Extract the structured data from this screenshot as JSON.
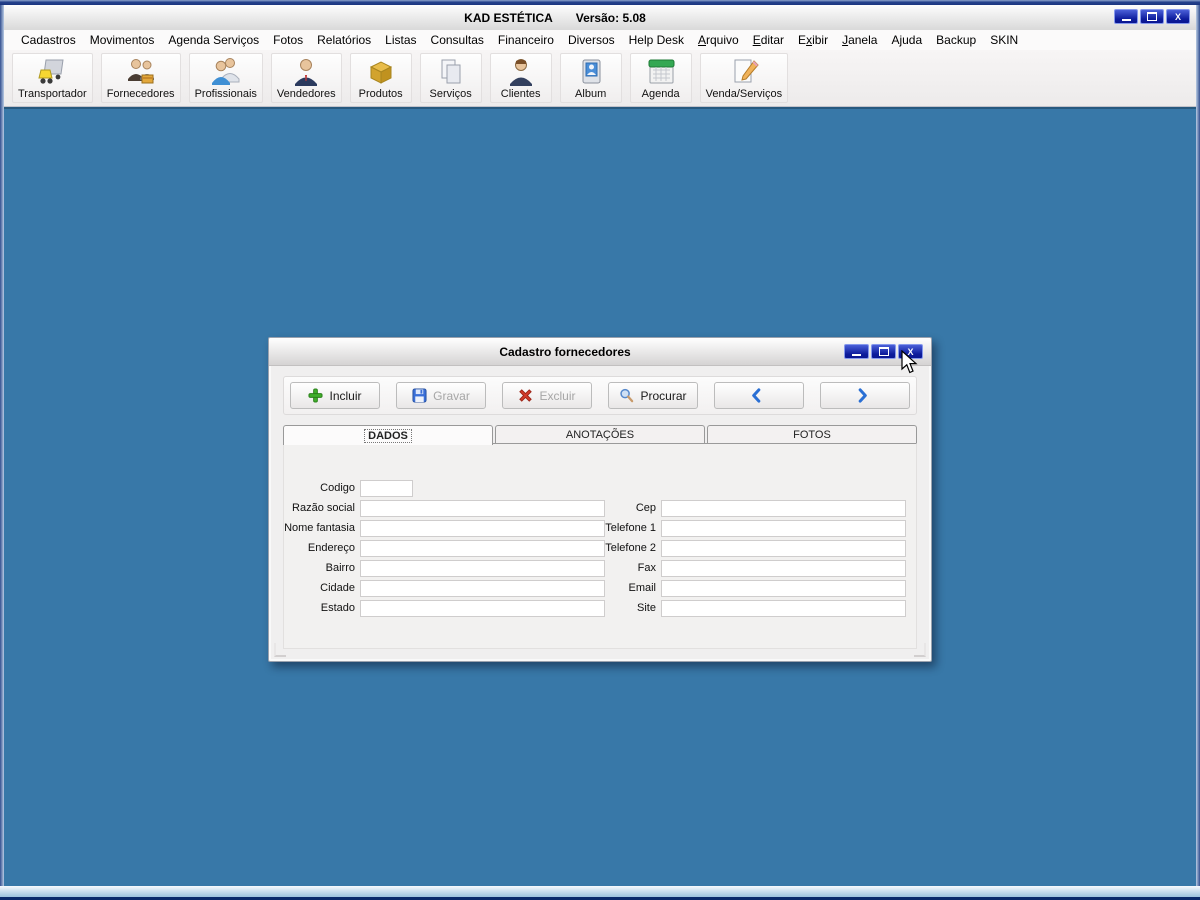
{
  "titlebar": {
    "app_title": "KAD ESTÉTICA",
    "version": "Versão: 5.08",
    "close_glyph": "X"
  },
  "menubar": {
    "items": [
      {
        "pre": "Cadastros",
        "accel": "",
        "rest": ""
      },
      {
        "pre": "Movimentos",
        "accel": "",
        "rest": ""
      },
      {
        "pre": "Agenda Serviços",
        "accel": "",
        "rest": ""
      },
      {
        "pre": "Fotos",
        "accel": "",
        "rest": ""
      },
      {
        "pre": "Relatórios",
        "accel": "",
        "rest": ""
      },
      {
        "pre": "Listas",
        "accel": "",
        "rest": ""
      },
      {
        "pre": "Consultas",
        "accel": "",
        "rest": ""
      },
      {
        "pre": "Financeiro",
        "accel": "",
        "rest": ""
      },
      {
        "pre": "Diversos",
        "accel": "",
        "rest": ""
      },
      {
        "pre": "Help Desk",
        "accel": "",
        "rest": ""
      },
      {
        "pre": "",
        "accel": "A",
        "rest": "rquivo"
      },
      {
        "pre": "",
        "accel": "E",
        "rest": "ditar"
      },
      {
        "pre": "E",
        "accel": "x",
        "rest": "ibir"
      },
      {
        "pre": "",
        "accel": "J",
        "rest": "anela"
      },
      {
        "pre": "Ajuda",
        "accel": "",
        "rest": ""
      },
      {
        "pre": "Backup",
        "accel": "",
        "rest": ""
      },
      {
        "pre": "SKIN",
        "accel": "",
        "rest": ""
      }
    ]
  },
  "toolbar": {
    "buttons": [
      {
        "label": "Transportador",
        "icon": "truck-icon"
      },
      {
        "label": "Fornecedores",
        "icon": "suppliers-icon"
      },
      {
        "label": "Profissionais",
        "icon": "professionals-icon"
      },
      {
        "label": "Vendedores",
        "icon": "salesperson-icon"
      },
      {
        "label": "Produtos",
        "icon": "box-icon"
      },
      {
        "label": "Serviços",
        "icon": "documents-icon"
      },
      {
        "label": "Clientes",
        "icon": "client-icon"
      },
      {
        "label": "Album",
        "icon": "photo-card-icon"
      },
      {
        "label": "Agenda",
        "icon": "calendar-icon"
      },
      {
        "label": "Venda/Serviços",
        "icon": "note-pencil-icon"
      }
    ]
  },
  "dialog": {
    "title": "Cadastro fornecedores",
    "close_glyph": "X",
    "action_buttons": [
      {
        "label": "Incluir",
        "icon": "add-icon",
        "enabled": true
      },
      {
        "label": "Gravar",
        "icon": "save-icon",
        "enabled": false
      },
      {
        "label": "Excluir",
        "icon": "delete-icon",
        "enabled": false
      },
      {
        "label": "Procurar",
        "icon": "search-icon",
        "enabled": true
      },
      {
        "label": "",
        "icon": "chevron-left-icon",
        "enabled": true
      },
      {
        "label": "",
        "icon": "chevron-right-icon",
        "enabled": true
      }
    ],
    "tabs": [
      {
        "label": "DADOS",
        "active": true
      },
      {
        "label": "ANOTAÇÕES",
        "active": false
      },
      {
        "label": "FOTOS",
        "active": false
      }
    ],
    "form": {
      "left_fields": [
        {
          "label": "Codigo",
          "value": ""
        },
        {
          "label": "Razão social",
          "value": ""
        },
        {
          "label": "Nome fantasia",
          "value": ""
        },
        {
          "label": "Endereço",
          "value": ""
        },
        {
          "label": "Bairro",
          "value": ""
        },
        {
          "label": "Cidade",
          "value": ""
        },
        {
          "label": "Estado",
          "value": ""
        }
      ],
      "right_fields": [
        {
          "label": "Cep",
          "value": ""
        },
        {
          "label": "Telefone 1",
          "value": ""
        },
        {
          "label": "Telefone 2",
          "value": ""
        },
        {
          "label": "Fax",
          "value": ""
        },
        {
          "label": "Email",
          "value": ""
        },
        {
          "label": "Site",
          "value": ""
        }
      ]
    }
  },
  "colors": {
    "desktop_blue": "#3878A8",
    "window_button_blue": "#0d1c9c",
    "accent_green": "#3fae2a",
    "accent_red": "#d43b2a",
    "save_blue": "#3a6fd8"
  }
}
